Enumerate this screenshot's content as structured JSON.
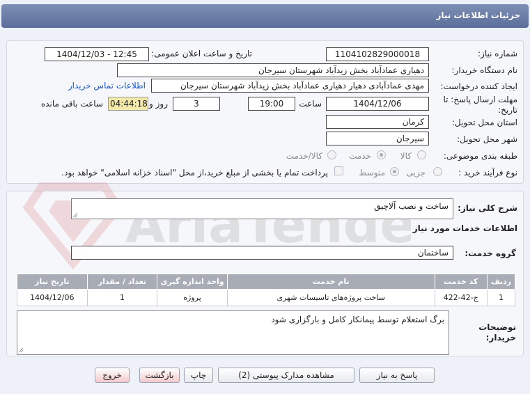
{
  "header": {
    "title": "جزئیات اطلاعات نیاز"
  },
  "form": {
    "need_number_label": "شماره نیاز:",
    "need_number": "1104102829000018",
    "announce_label": "تاریخ و ساعت اعلان عمومی:",
    "announce_value": "1404/12/03 - 12:45",
    "buyer_org_label": "نام دستگاه خریدار:",
    "buyer_org": "دهیاری عمادآباد بخش زیدآباد شهرستان سیرجان",
    "creator_label": "ایجاد کننده درخواست:",
    "creator": "مهدی عمادآبادی دهیار دهیاری عمادآباد بخش زیدآباد شهرستان سیرجان",
    "contact_link": "اطلاعات تماس خریدار",
    "deadline_label_1": "مهلت ارسال پاسخ: تا",
    "deadline_label_2": "تاریخ:",
    "deadline_date": "1404/12/06",
    "time_label": "ساعت",
    "deadline_time": "19:00",
    "days": "3",
    "days_label": "روز و",
    "remaining": "04:44:18",
    "remaining_label": "ساعت باقی مانده",
    "province_label": "استان محل تحویل:",
    "province": "کرمان",
    "city_label": "شهر محل تحویل:",
    "city": "سیرجان",
    "category_label": "طبقه بندی موضوعی:",
    "category_options": [
      "کالا",
      "خدمت",
      "کالا/خدمت"
    ],
    "category_selected": "خدمت",
    "process_label": "نوع فرآیند خرید :",
    "process_options": [
      "جزیی",
      "متوسط"
    ],
    "process_selected": "متوسط",
    "payment_note": "پرداخت تمام یا بخشی از مبلغ خرید،از محل \"اسناد خزانه اسلامی\" خواهد بود."
  },
  "summary": {
    "label": "شرح کلی نیاز:",
    "value": "ساخت و نصب آلاچیق"
  },
  "services": {
    "section_title": "اطلاعات خدمات مورد نیاز",
    "group_label": "گروه خدمت:",
    "group_value": "ساختمان",
    "columns": [
      "ردیف",
      "کد خدمت",
      "نام خدمت",
      "واحد اندازه گیری",
      "تعداد / مقدار",
      "تاریخ نیاز"
    ],
    "rows": [
      {
        "row": "1",
        "code": "ج-42-422",
        "name": "ساخت پروژه‌های تاسیسات شهری",
        "unit": "پروژه",
        "qty": "1",
        "date": "1404/12/06"
      }
    ]
  },
  "buyer_notes": {
    "label_1": "توضیحات",
    "label_2": "خریدار:",
    "value": "برگ استعلام توسط پیمانکار کامل و بارگزاری شود"
  },
  "buttons": {
    "reply": "پاسخ به نیاز",
    "attachments": "مشاهده مدارک پیوستی (2)",
    "print": "چاپ",
    "back": "بازگشت",
    "exit": "خروج"
  },
  "watermark": {
    "text": "AriaTender.neT"
  },
  "colors": {
    "header": "#6a7ca6",
    "panel": "#f6f7fa",
    "table_header": "#a8acb5",
    "link": "#1a57c7",
    "timer_bg": "#f3e9a8"
  }
}
